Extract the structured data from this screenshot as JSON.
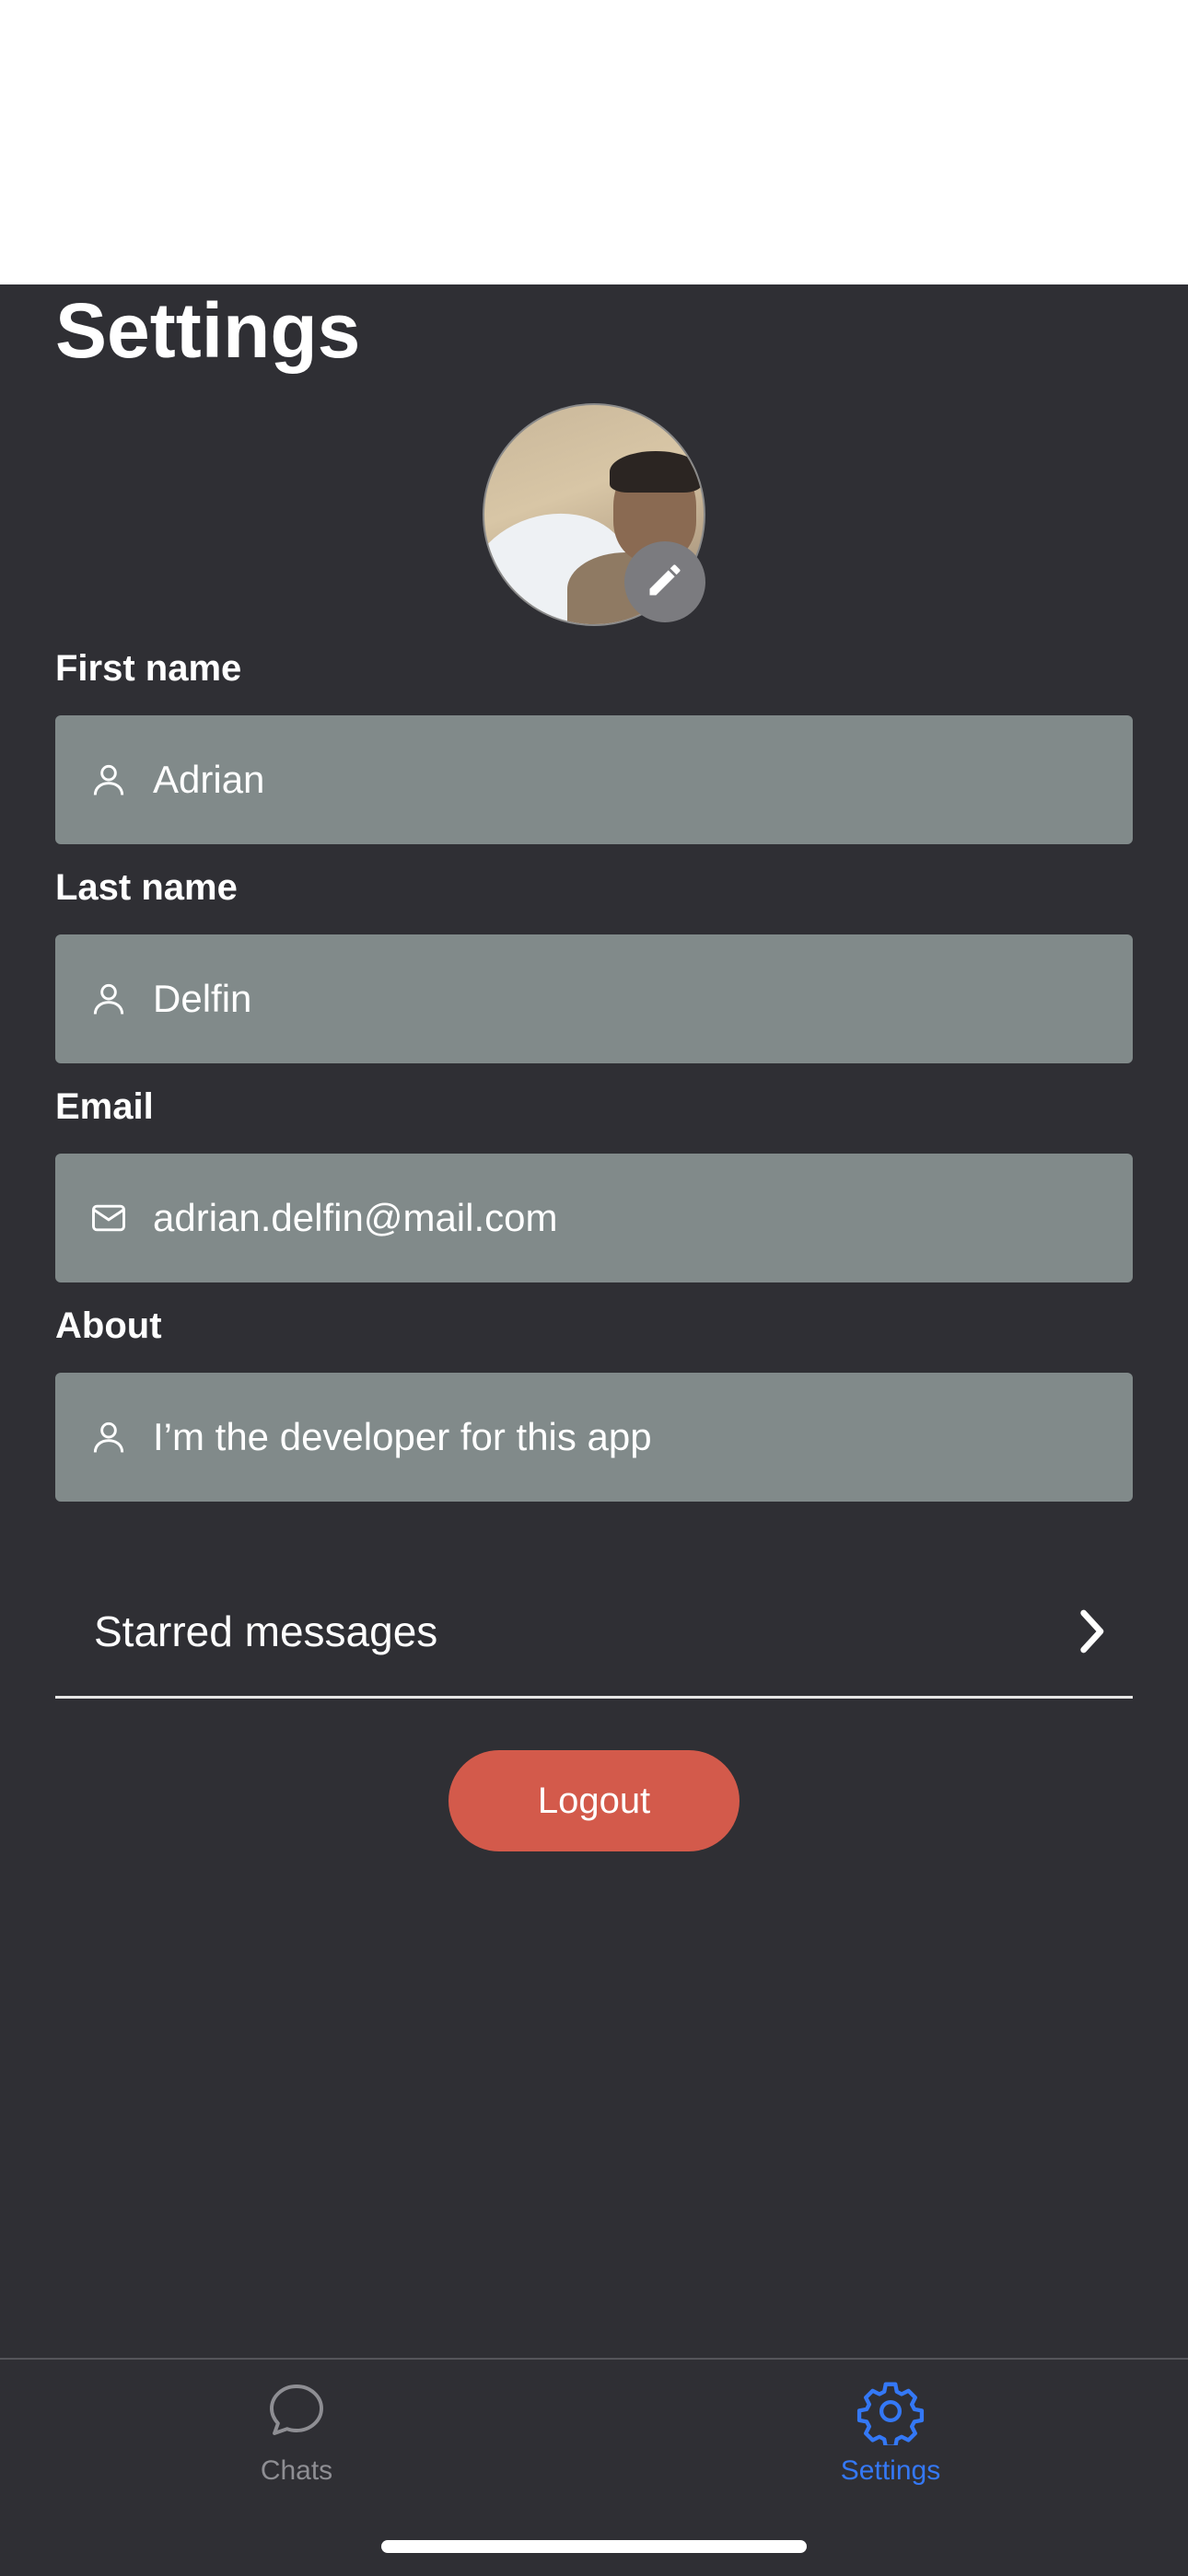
{
  "header": {
    "title": "Settings"
  },
  "profile": {
    "avatar_icon": "user-photo",
    "edit_icon": "pencil-icon"
  },
  "fields": [
    {
      "label": "First name",
      "value": "Adrian",
      "icon": "user-icon"
    },
    {
      "label": "Last name",
      "value": "Delfin",
      "icon": "user-icon"
    },
    {
      "label": "Email",
      "value": "adrian.delfin@mail.com",
      "icon": "mail-icon"
    },
    {
      "label": "About",
      "value": "I’m the developer for this app",
      "icon": "user-icon"
    }
  ],
  "starred": {
    "label": "Starred messages",
    "icon": "chevron-right-icon"
  },
  "logout": {
    "label": "Logout",
    "color": "#d35a4b"
  },
  "tabbar": {
    "items": [
      {
        "label": "Chats",
        "icon": "chat-bubble-icon",
        "active": false,
        "color": "#8e8e93"
      },
      {
        "label": "Settings",
        "icon": "gear-icon",
        "active": true,
        "color": "#3478f6"
      }
    ]
  },
  "colors": {
    "background": "#2f2f34",
    "field_background": "#818a8a",
    "accent": "#3478f6"
  }
}
